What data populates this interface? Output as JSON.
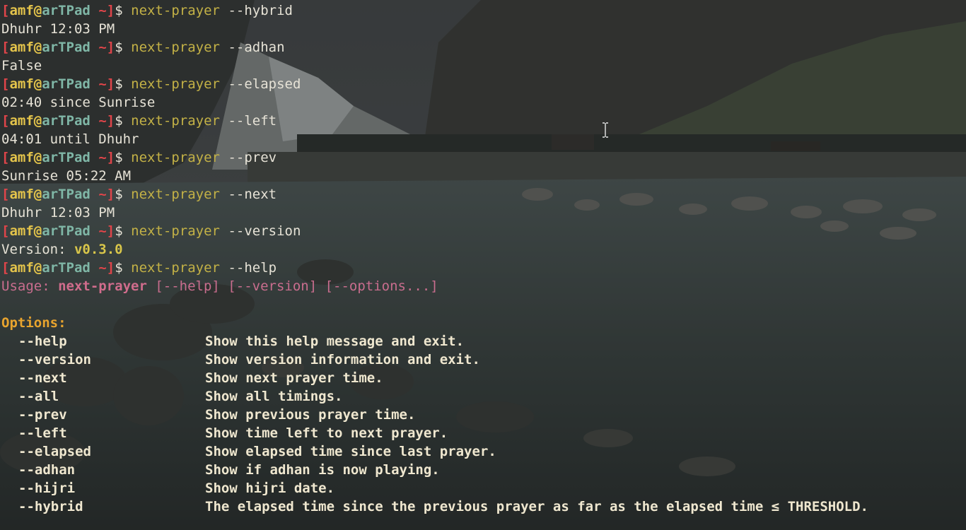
{
  "prompt": {
    "user": "amf",
    "at": "@",
    "host": "arTPad",
    "dir": "~",
    "open": "[",
    "close": "]",
    "dollar": "$"
  },
  "session": [
    {
      "command": "next-prayer",
      "args": "--hybrid",
      "output": "Dhuhr 12:03 PM"
    },
    {
      "command": "next-prayer",
      "args": "--adhan",
      "output": "False"
    },
    {
      "command": "next-prayer",
      "args": "--elapsed",
      "output": "02:40 since Sunrise"
    },
    {
      "command": "next-prayer",
      "args": "--left",
      "output": "04:01 until Dhuhr"
    },
    {
      "command": "next-prayer",
      "args": "--prev",
      "output": "Sunrise 05:22 AM"
    },
    {
      "command": "next-prayer",
      "args": "--next",
      "output": "Dhuhr 12:03 PM"
    },
    {
      "command": "next-prayer",
      "args": "--version",
      "output_label": "Version: ",
      "output_value": "v0.3.0"
    },
    {
      "command": "next-prayer",
      "args": "--help"
    }
  ],
  "help": {
    "usage_label": "Usage: ",
    "usage_prog": "next-prayer",
    "usage_rest": " [--help] [--version] [--options...]",
    "options_heading": "Options:",
    "options": [
      {
        "name": "--help",
        "desc": "Show this help message and exit."
      },
      {
        "name": "--version",
        "desc": "Show version information and exit."
      },
      {
        "name": "--next",
        "desc": "Show next prayer time."
      },
      {
        "name": "--all",
        "desc": "Show all timings."
      },
      {
        "name": "--prev",
        "desc": "Show previous prayer time."
      },
      {
        "name": "--left",
        "desc": "Show time left to next prayer."
      },
      {
        "name": "--elapsed",
        "desc": "Show elapsed time since last prayer."
      },
      {
        "name": "--adhan",
        "desc": "Show if adhan is now playing."
      },
      {
        "name": "--hijri",
        "desc": "Show hijri date."
      },
      {
        "name": "--hybrid",
        "desc": "The elapsed time since the previous prayer as far as the elapsed time ≤ THRESHOLD."
      }
    ]
  },
  "colors": {
    "prompt_bracket": "#e0454a",
    "prompt_user": "#e4c44b",
    "prompt_host": "#7fb6a6",
    "command": "#c3b146",
    "usage": "#c96d8e",
    "options_heading": "#e8a42e"
  }
}
